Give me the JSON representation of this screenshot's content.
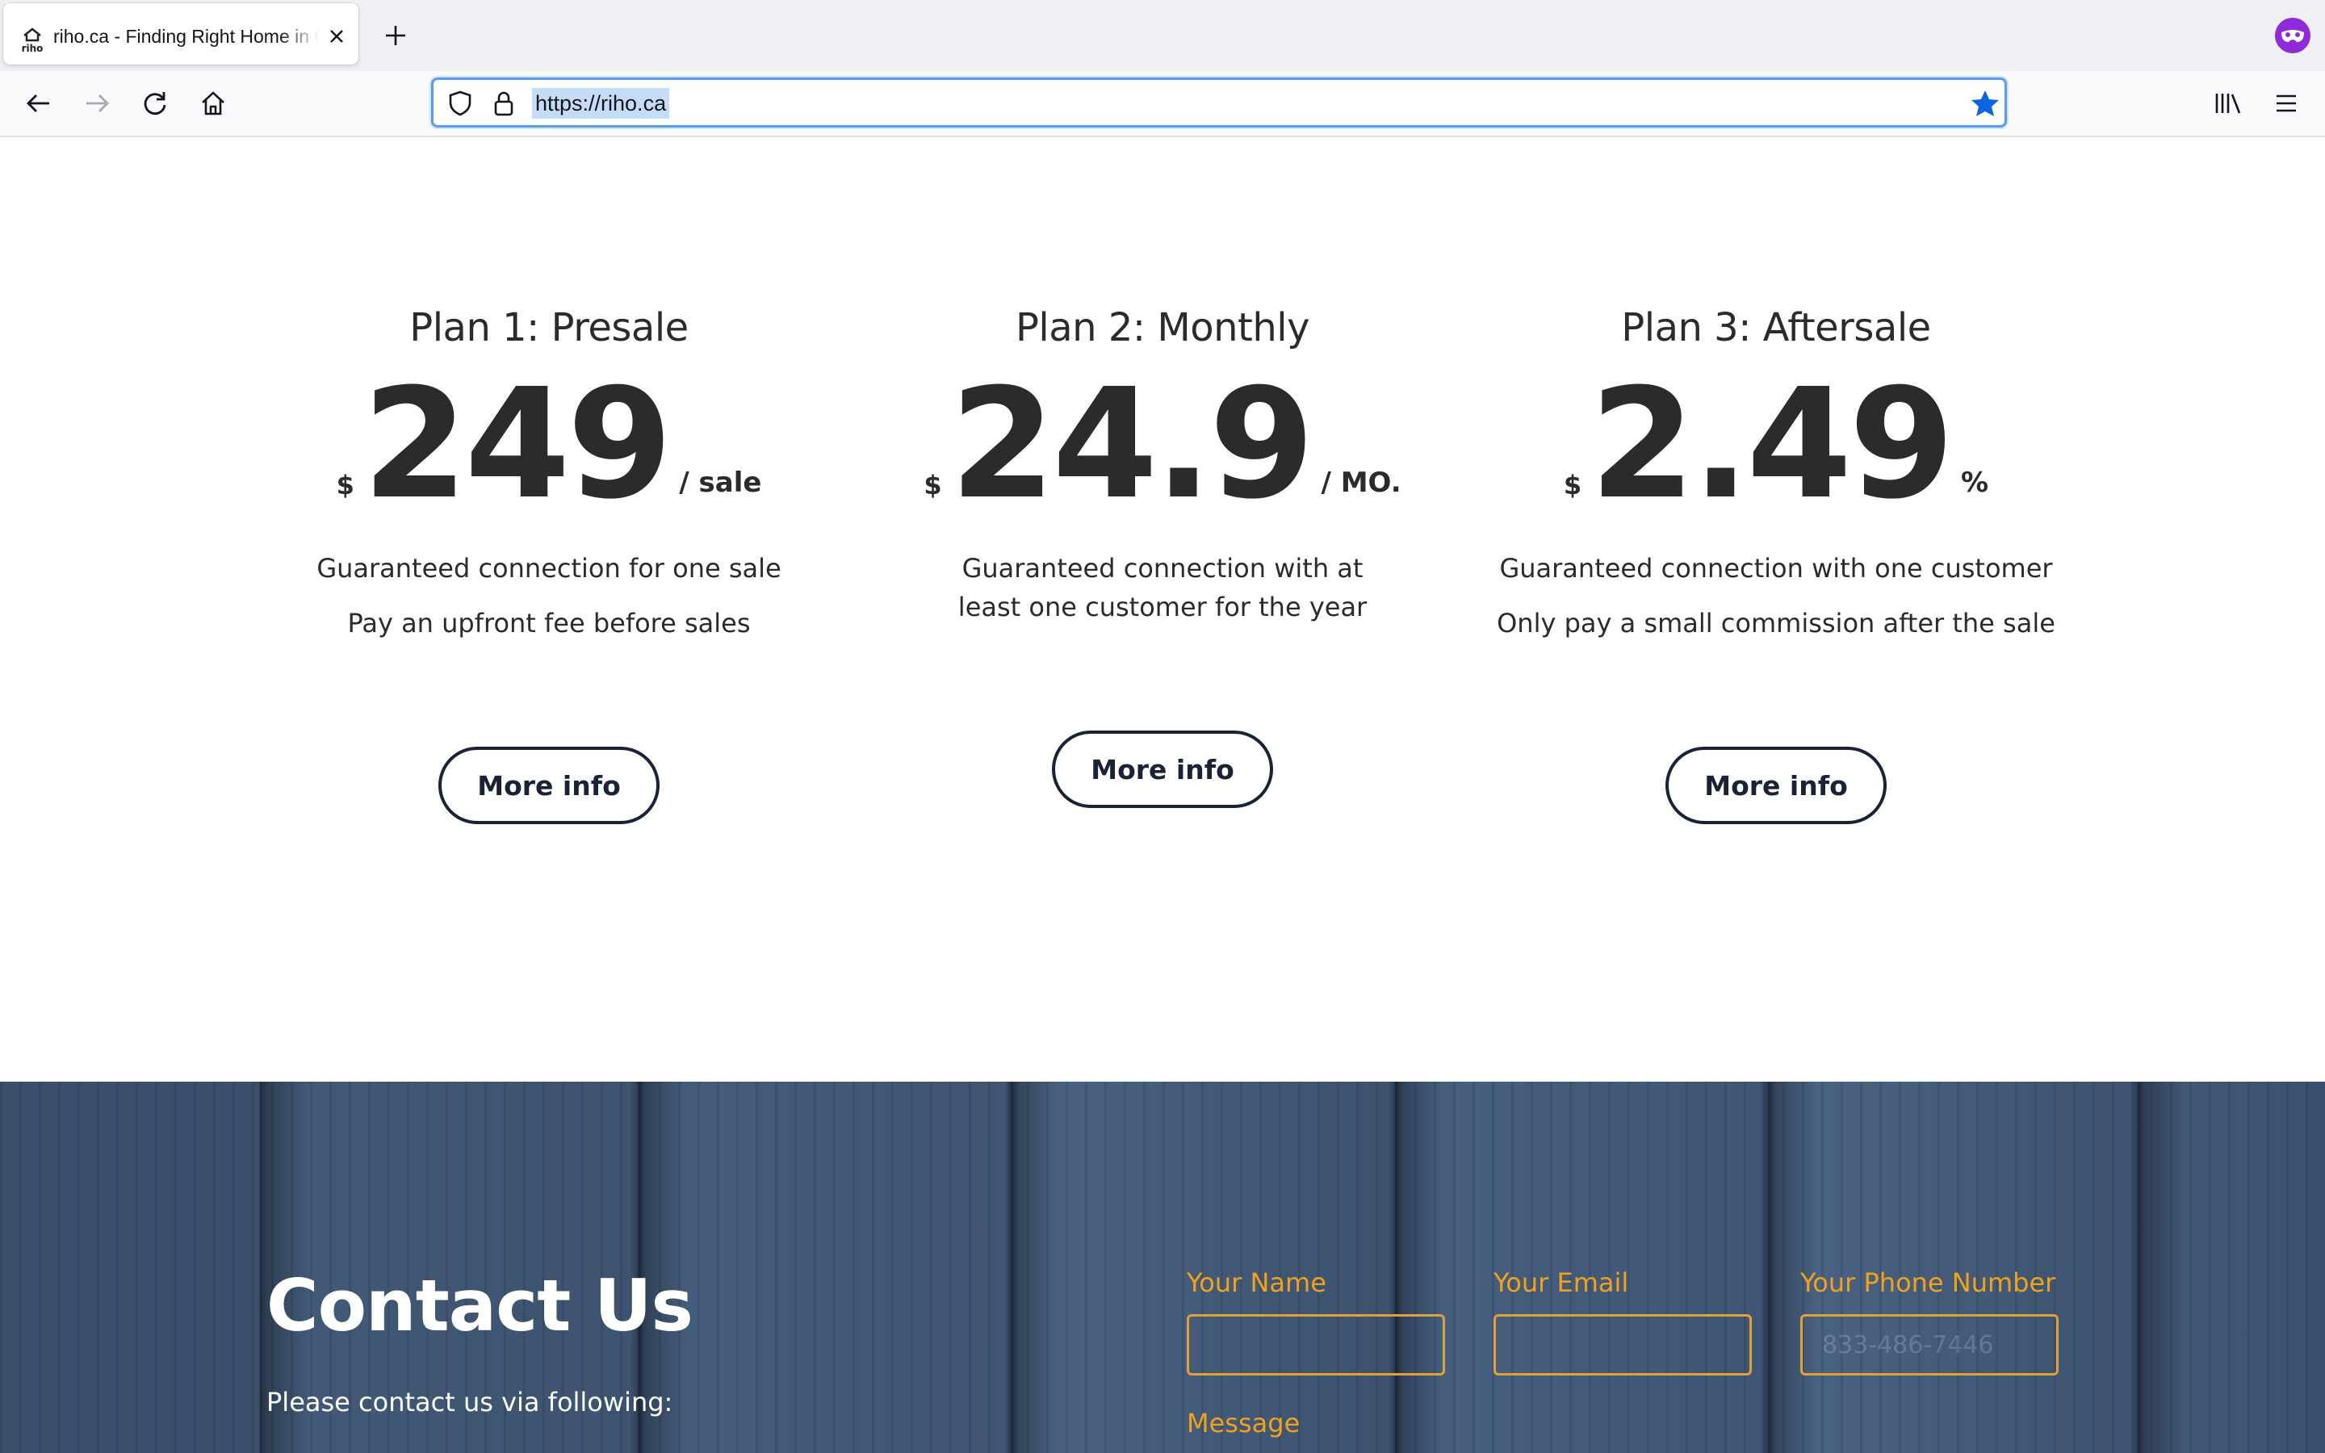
{
  "browser": {
    "tab_title": "riho.ca - Finding Right Home in Canada",
    "url": "https://riho.ca"
  },
  "plans": [
    {
      "title": "Plan 1: Presale",
      "currency": "$",
      "amount": "249",
      "unit": "/ sale",
      "desc1": "Guaranteed connection for one sale",
      "desc2": "Pay an upfront fee before sales",
      "button": "More info"
    },
    {
      "title": "Plan 2: Monthly",
      "currency": "$",
      "amount": "24.9",
      "unit": "/ MO.",
      "desc1": "Guaranteed connection with at least one customer for the year",
      "desc2": "",
      "button": "More info"
    },
    {
      "title": "Plan 3: Aftersale",
      "currency": "$",
      "amount": "2.49",
      "unit": "%",
      "desc1": "Guaranteed connection with one customer",
      "desc2": "Only pay a small commission after the sale",
      "button": "More info"
    }
  ],
  "contact": {
    "title": "Contact Us",
    "subtitle": "Please contact us via following:",
    "name_label": "Your Name",
    "email_label": "Your Email",
    "phone_label": "Your Phone Number",
    "phone_placeholder": "833-486-7446",
    "message_label": "Message"
  },
  "colors": {
    "accent_orange": "#f0a21c",
    "button_navy": "#1a2236",
    "url_focus": "#5b9ce8",
    "account_purple": "#8f2bd8"
  }
}
